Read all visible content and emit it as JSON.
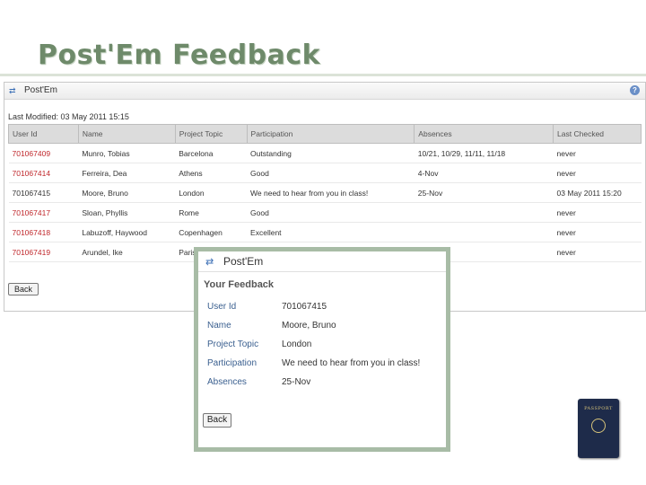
{
  "slide": {
    "title": "Post'Em Feedback"
  },
  "window": {
    "title": "Post'Em",
    "help": "?"
  },
  "last_modified": "Last Modified: 03 May 2011 15:15",
  "table": {
    "headers": [
      "User Id",
      "Name",
      "Project Topic",
      "Participation",
      "Absences",
      "Last Checked"
    ],
    "rows": [
      [
        "701067409",
        "Munro, Tobias",
        "Barcelona",
        "Outstanding",
        "10/21, 10/29, 11/11, 11/18",
        "never"
      ],
      [
        "701067414",
        "Ferreira, Dea",
        "Athens",
        "Good",
        "4-Nov",
        "never"
      ],
      [
        "701067415",
        "Moore, Bruno",
        "London",
        "We need to hear from you in class!",
        "25-Nov",
        "03 May 2011 15:20"
      ],
      [
        "701067417",
        "Sloan, Phyllis",
        "Rome",
        "Good",
        "",
        "never"
      ],
      [
        "701067418",
        "Labuzoff, Haywood",
        "Copenhagen",
        "Excellent",
        "",
        "never"
      ],
      [
        "701067419",
        "Arundel, Ike",
        "Paris",
        "",
        "",
        "never"
      ]
    ],
    "highlight_color": "#c0282c"
  },
  "back_label": "Back",
  "popup": {
    "title": "Post'Em",
    "heading": "Your Feedback",
    "fields": [
      {
        "label": "User Id",
        "value": "701067415"
      },
      {
        "label": "Name",
        "value": "Moore, Bruno"
      },
      {
        "label": "Project Topic",
        "value": "London"
      },
      {
        "label": "Participation",
        "value": "We need to hear from you in class!"
      },
      {
        "label": "Absences",
        "value": "25-Nov"
      }
    ],
    "back_label": "Back",
    "border_color": "#a8bca6"
  },
  "icons": {
    "app": "postem-arrows-icon",
    "help": "help-icon",
    "decor": "passport-icon"
  },
  "passport": {
    "label": "PASSPORT"
  }
}
